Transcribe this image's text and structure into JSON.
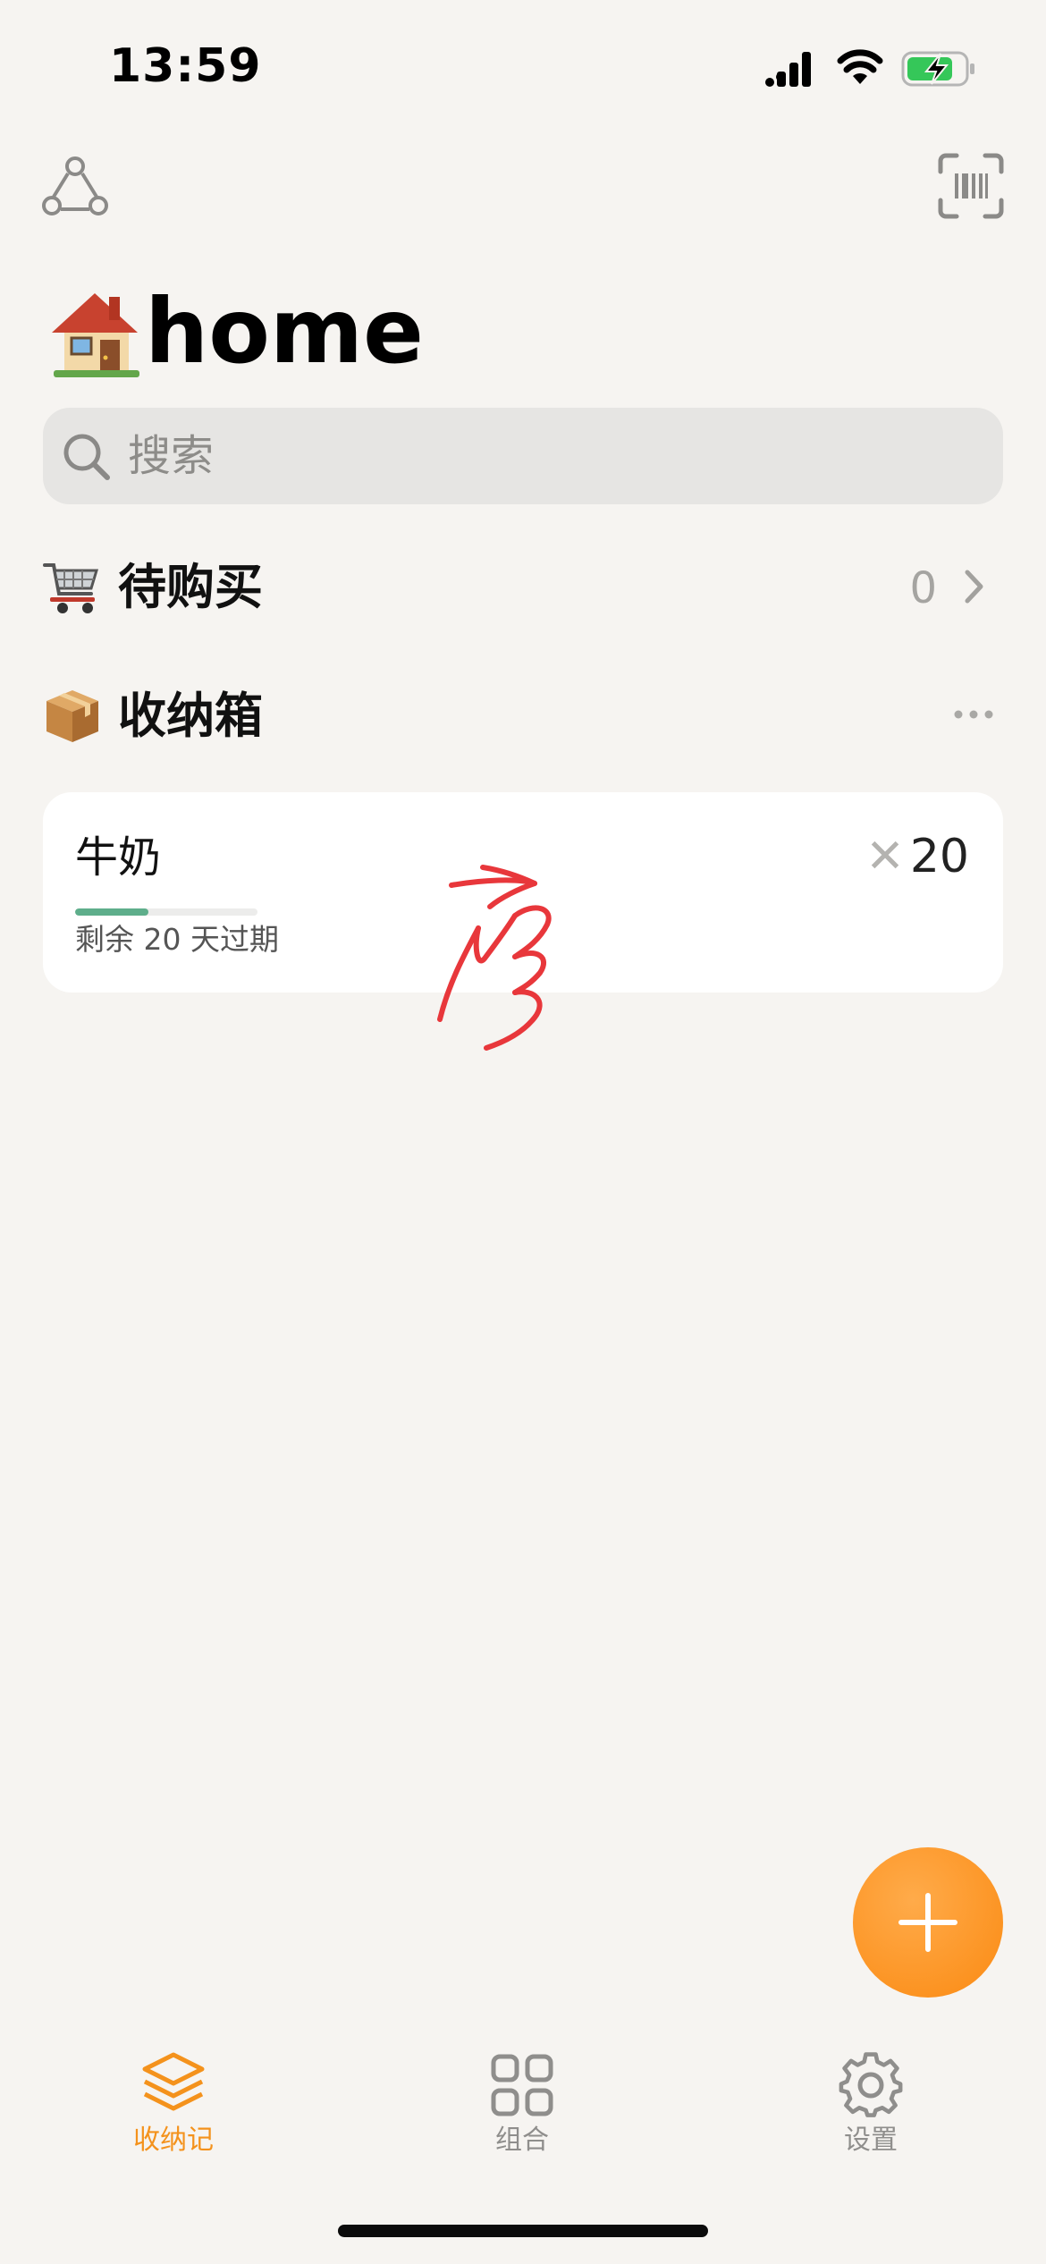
{
  "status_bar": {
    "time": "13:59",
    "icons": [
      "signal-icon",
      "wifi-icon",
      "battery-charging-icon"
    ],
    "battery_color": "#35c759"
  },
  "toolbar": {
    "left_icon": "share-icon",
    "right_icon": "barcode-scan-icon"
  },
  "header": {
    "title_emoji": "house-emoji",
    "title": "home"
  },
  "search": {
    "placeholder": "搜索"
  },
  "sections": {
    "shopping": {
      "icon": "shopping-cart-emoji",
      "label": "待购买",
      "count": "0"
    },
    "storage": {
      "icon": "package-emoji",
      "label": "收纳箱"
    }
  },
  "items": [
    {
      "name": "牛奶",
      "quantity": "20",
      "quantity_prefix": "✕",
      "expiry_text": "剩余 20 天过期",
      "freshness_fraction": 0.4,
      "freshness_color": "#5eae8b"
    }
  ],
  "fab": {
    "icon": "plus-icon",
    "color": "#fb8a12"
  },
  "tab_bar": {
    "tabs": [
      {
        "label": "收纳记",
        "icon": "layers-icon",
        "active": true
      },
      {
        "label": "组合",
        "icon": "grid-icon",
        "active": false
      },
      {
        "label": "设置",
        "icon": "gear-icon",
        "active": false
      }
    ],
    "active_color": "#f4921c",
    "inactive_color": "#8f8e8c"
  },
  "annotation": {
    "icon": "swipe-gesture-icon",
    "color": "#e8373b"
  }
}
